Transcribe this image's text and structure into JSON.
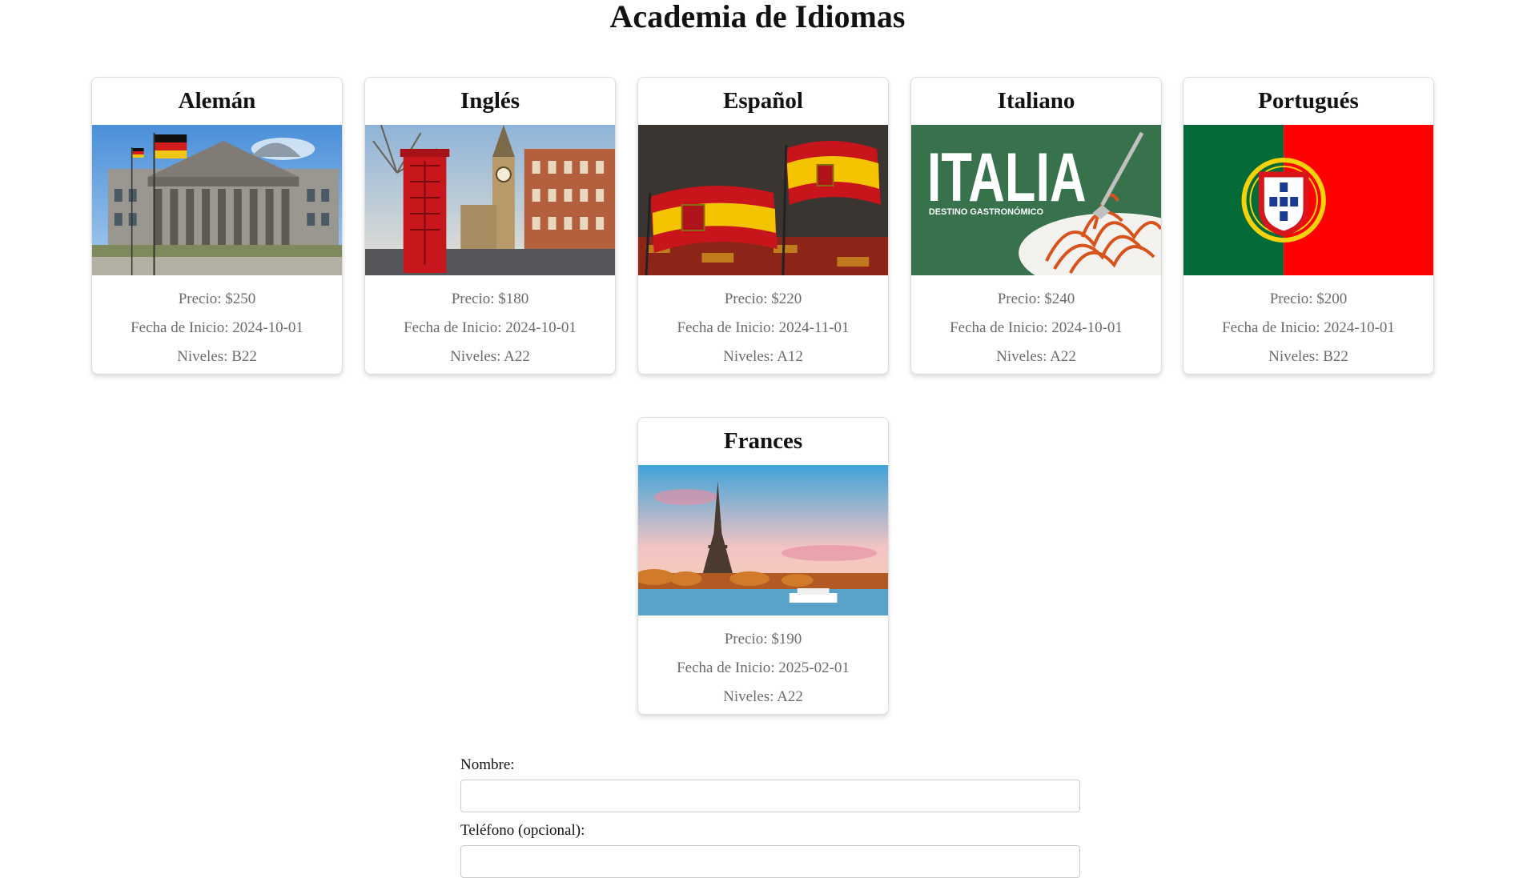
{
  "page": {
    "title": "Academia de Idiomas"
  },
  "courses": [
    {
      "name": "Alemán",
      "price": "Precio: $250",
      "start": "Fecha de Inicio: 2024-10-01",
      "levels": "Niveles: B22"
    },
    {
      "name": "Inglés",
      "price": "Precio: $180",
      "start": "Fecha de Inicio: 2024-10-01",
      "levels": "Niveles: A22"
    },
    {
      "name": "Español",
      "price": "Precio: $220",
      "start": "Fecha de Inicio: 2024-11-01",
      "levels": "Niveles: A12"
    },
    {
      "name": "Italiano",
      "price": "Precio: $240",
      "start": "Fecha de Inicio: 2024-10-01",
      "levels": "Niveles: A22",
      "image_text": "ITALIA",
      "image_subtext": "DESTINO GASTRONÓMICO"
    },
    {
      "name": "Portugués",
      "price": "Precio: $200",
      "start": "Fecha de Inicio: 2024-10-01",
      "levels": "Niveles: B22"
    },
    {
      "name": "Frances",
      "price": "Precio: $190",
      "start": "Fecha de Inicio: 2025-02-01",
      "levels": "Niveles: A22"
    }
  ],
  "form": {
    "name_label": "Nombre:",
    "name_value": "",
    "phone_label": "Teléfono (opcional):",
    "phone_value": ""
  },
  "colors": {
    "card_border": "#dddddd",
    "info_text": "#6b6b6b",
    "input_border": "#cccccc"
  }
}
